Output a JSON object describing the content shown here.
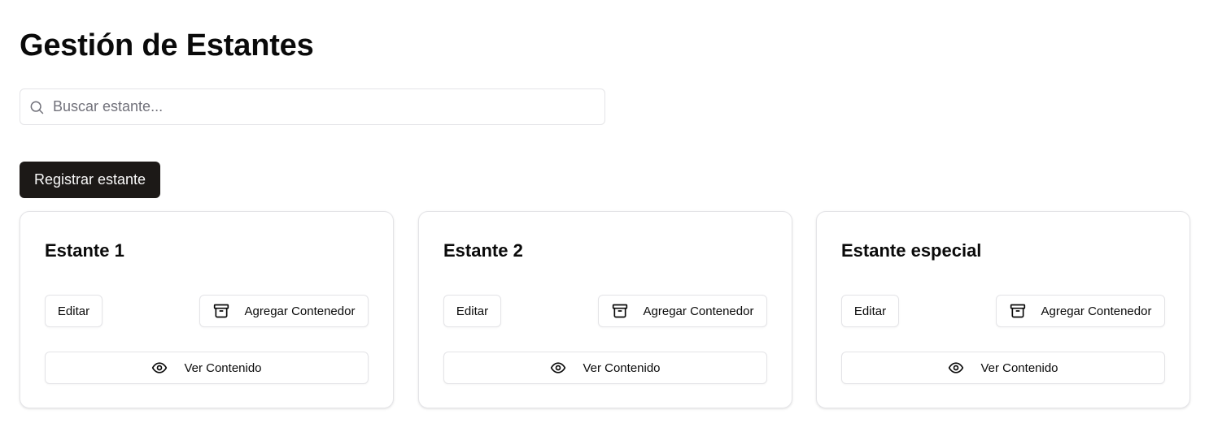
{
  "page": {
    "title": "Gestión de Estantes"
  },
  "search": {
    "placeholder": "Buscar estante...",
    "value": "",
    "icon": "search-icon"
  },
  "actions": {
    "register_label": "Registrar estante"
  },
  "colors": {
    "primary_button": "#1c1917",
    "border": "#e4e4e7",
    "placeholder": "#71717a"
  },
  "shelves": [
    {
      "name": "Estante 1",
      "edit_label": "Editar",
      "add_container_label": "Agregar Contenedor",
      "add_container_icon": "archive-icon",
      "view_content_label": "Ver Contenido",
      "view_content_icon": "eye-icon"
    },
    {
      "name": "Estante 2",
      "edit_label": "Editar",
      "add_container_label": "Agregar Contenedor",
      "add_container_icon": "archive-icon",
      "view_content_label": "Ver Contenido",
      "view_content_icon": "eye-icon"
    },
    {
      "name": "Estante especial",
      "edit_label": "Editar",
      "add_container_label": "Agregar Contenedor",
      "add_container_icon": "archive-icon",
      "view_content_label": "Ver Contenido",
      "view_content_icon": "eye-icon"
    }
  ]
}
